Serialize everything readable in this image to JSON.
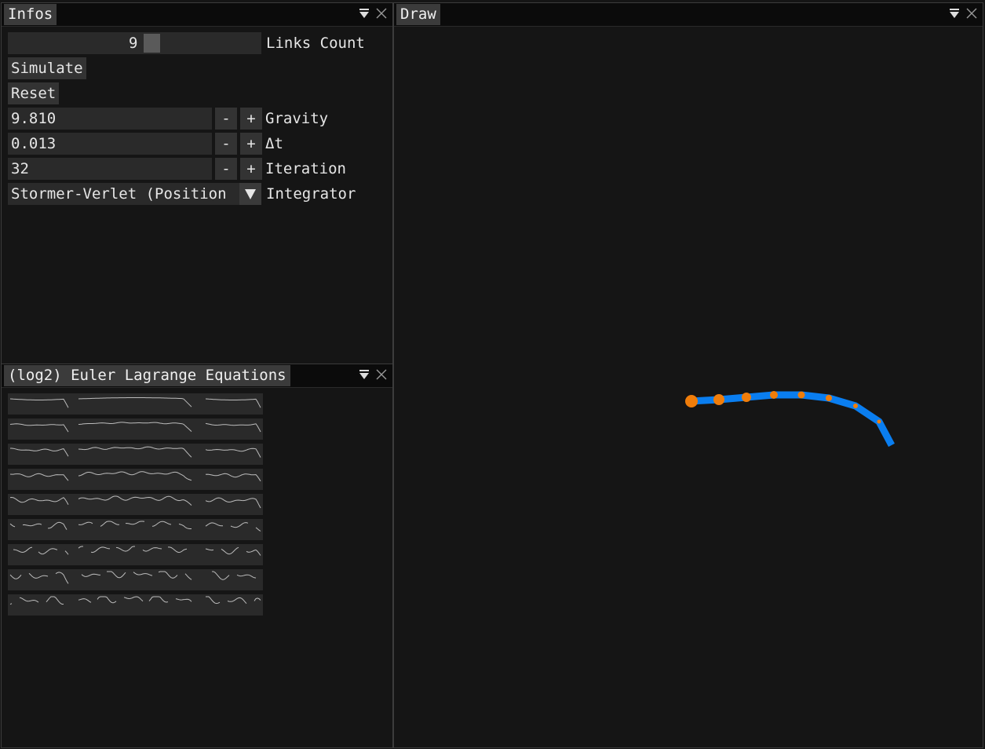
{
  "infos_panel": {
    "title": "Infos",
    "links_count": {
      "value": "9",
      "label": "Links Count"
    },
    "simulate_label": "Simulate",
    "reset_label": "Reset",
    "gravity": {
      "value": "9.810",
      "label": "Gravity",
      "minus": "-",
      "plus": "+"
    },
    "dt": {
      "value": "0.013",
      "label": "Δt",
      "minus": "-",
      "plus": "+"
    },
    "iteration": {
      "value": "32",
      "label": "Iteration",
      "minus": "-",
      "plus": "+"
    },
    "integrator": {
      "value": "Stormer-Verlet (Position",
      "label": "Integrator"
    }
  },
  "equations_panel": {
    "title": "(log2) Euler Lagrange Equations",
    "rows": 9
  },
  "draw_panel": {
    "title": "Draw",
    "chain": {
      "link_count": 9,
      "node_count": 8
    }
  },
  "colors": {
    "chain_link": "#0a7ef0",
    "chain_node": "#f07d0a",
    "panel_bg": "#151515",
    "frame_bg": "#2a2a2a",
    "tab_active": "#3b3b3b"
  },
  "icons": {
    "collapse": "dropdown-menu-icon",
    "close": "close-icon",
    "combo": "chevron-down-icon"
  }
}
